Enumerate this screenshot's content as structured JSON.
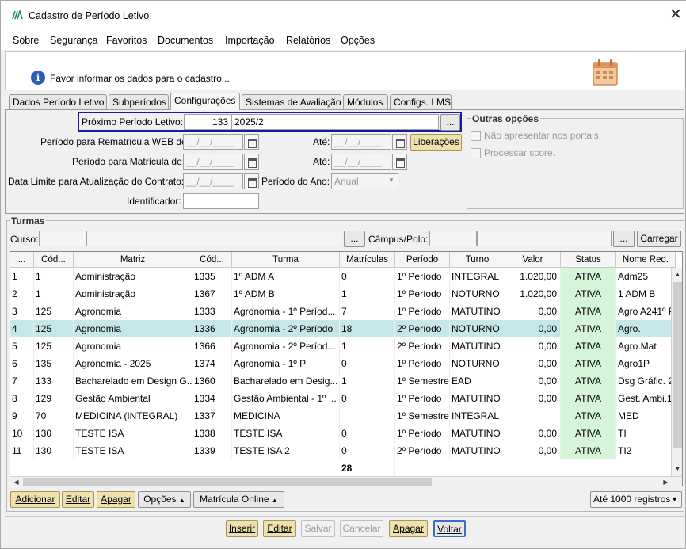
{
  "window": {
    "title": "Cadastro de Período Letivo",
    "close": "✕"
  },
  "menu": [
    "Sobre",
    "Segurança",
    "Favoritos",
    "Documentos",
    "Importação",
    "Relatórios",
    "Opções"
  ],
  "info": {
    "icon_char": "i",
    "text": "Favor informar os dados para o cadastro..."
  },
  "tabs": [
    "Dados Período Letivo",
    "Subperíodos",
    "Configurações",
    "Sistemas de Avaliação",
    "Módulos",
    "Configs. LMS"
  ],
  "form": {
    "proximo_label": "Próximo Período Letivo:",
    "proximo_code": "133",
    "proximo_value": "2025/2",
    "lookup_button": "...",
    "rematricula_label": "Período para Rematrícula WEB de:",
    "matricula_label": "Período para Matrícula de:",
    "data_limite_label": "Data Limite para Atualização do Contrato:",
    "ate_label": "Até:",
    "date_placeholder": "__/__/____",
    "liberacoes_button": "Liberações",
    "periodo_ano_label": "Período do Ano:",
    "periodo_ano_value": "Anual",
    "identificador_label": "Identificador:"
  },
  "outras": {
    "title": "Outras opções",
    "options": [
      "Não apresentar nos portais.",
      "Processar score."
    ]
  },
  "turmas": {
    "title": "Turmas",
    "curso_label": "Curso:",
    "campus_label": "Câmpus/Polo:",
    "carregar_button": "Carregar",
    "lookup": "...",
    "columns": [
      "...",
      "Cód...",
      "Matriz",
      "Cód...",
      "Turma",
      "Matrículas",
      "Período",
      "Turno",
      "Valor",
      "Status",
      "Nome Red."
    ],
    "rows": [
      [
        "1",
        "1",
        "Administração",
        "1335",
        "1º ADM A",
        "0",
        "1º Período",
        "INTEGRAL",
        "1.020,00",
        "ATIVA",
        "Adm25"
      ],
      [
        "2",
        "1",
        "Administração",
        "1367",
        "1º ADM B",
        "1",
        "1º Período",
        "NOTURNO",
        "1.020,00",
        "ATIVA",
        "1 ADM B"
      ],
      [
        "3",
        "125",
        "Agronomia",
        "1333",
        "Agronomia - 1º Períod...",
        "7",
        "1º Período",
        "MATUTINO",
        "0,00",
        "ATIVA",
        "Agro A241º P"
      ],
      [
        "4",
        "125",
        "Agronomia",
        "1336",
        "Agronomia - 2º Período",
        "18",
        "2º Período",
        "NOTURNO",
        "0,00",
        "ATIVA",
        "Agro."
      ],
      [
        "5",
        "125",
        "Agronomia",
        "1366",
        "Agronomia - 2º Períod...",
        "1",
        "2º Período",
        "MATUTINO",
        "0,00",
        "ATIVA",
        "Agro.Mat"
      ],
      [
        "6",
        "135",
        "Agronomia - 2025",
        "1374",
        "Agronomia - 1º P",
        "0",
        "1º Período",
        "NOTURNO",
        "0,00",
        "ATIVA",
        "Agro1P"
      ],
      [
        "7",
        "133",
        "Bacharelado em Design G...",
        "1360",
        "Bacharelado em Desig...",
        "1",
        "1º Semestre",
        "EAD",
        "0,00",
        "ATIVA",
        "Dsg Gráfic. 2"
      ],
      [
        "8",
        "129",
        "Gestão Ambiental",
        "1334",
        "Gestão Ambiental - 1º ...",
        "0",
        "1º Período",
        "MATUTINO",
        "0,00",
        "ATIVA",
        "Gest. Ambi.1"
      ],
      [
        "9",
        "70",
        "MEDICINA (INTEGRAL)",
        "1337",
        "MEDICINA",
        "",
        "1º Semestre",
        "INTEGRAL",
        "",
        "ATIVA",
        "MED"
      ],
      [
        "10",
        "130",
        "TESTE ISA",
        "1338",
        "TESTE ISA",
        "0",
        "1º Período",
        "MATUTINO",
        "0,00",
        "ATIVA",
        "TI"
      ],
      [
        "11",
        "130",
        "TESTE ISA",
        "1339",
        "TESTE ISA 2",
        "0",
        "2º Período",
        "MATUTINO",
        "0,00",
        "ATIVA",
        "TI2"
      ]
    ],
    "selected_row": 4,
    "total_matriculas": "28",
    "buttons": [
      "Adicionar",
      "Editar",
      "Apagar"
    ],
    "opcoes_button": "Opções",
    "matricula_online_button": "Matrícula Online",
    "limit_select": "Até 1000 registros"
  },
  "footer_buttons": [
    "Inserir",
    "Editar",
    "Salvar",
    "Cancelar",
    "Apagar",
    "Voltar"
  ]
}
